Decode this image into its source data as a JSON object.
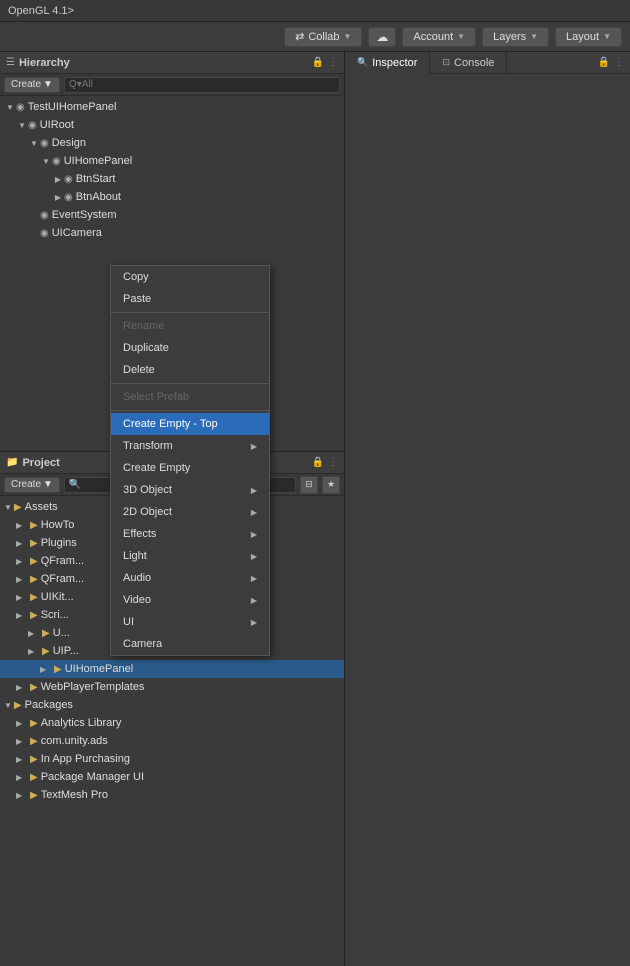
{
  "titleBar": {
    "text": "OpenGL 4.1>"
  },
  "toolbar": {
    "collab": "Collab",
    "account": "Account",
    "layers": "Layers",
    "layout": "Layout"
  },
  "hierarchy": {
    "title": "Hierarchy",
    "createBtn": "Create",
    "searchPlaceholder": "Q▾All",
    "items": [
      {
        "label": "TestUIHomePanel",
        "indent": 0,
        "toggle": "▼",
        "icon": "◉",
        "type": "root"
      },
      {
        "label": "UIRoot",
        "indent": 1,
        "toggle": "▼",
        "icon": "◉"
      },
      {
        "label": "Design",
        "indent": 2,
        "toggle": "▼",
        "icon": "◉"
      },
      {
        "label": "UIHomePanel",
        "indent": 3,
        "toggle": "▼",
        "icon": "◉"
      },
      {
        "label": "BtnStart",
        "indent": 4,
        "toggle": "▶",
        "icon": "◉"
      },
      {
        "label": "BtnAbout",
        "indent": 4,
        "toggle": "▶",
        "icon": "◉"
      },
      {
        "label": "EventSystem",
        "indent": 2,
        "toggle": "",
        "icon": "◉"
      },
      {
        "label": "UICamera",
        "indent": 2,
        "toggle": "",
        "icon": "◉"
      }
    ]
  },
  "contextMenu": {
    "items": [
      {
        "label": "Copy",
        "type": "normal"
      },
      {
        "label": "Paste",
        "type": "normal"
      },
      {
        "type": "separator"
      },
      {
        "label": "Rename",
        "type": "disabled"
      },
      {
        "label": "Duplicate",
        "type": "normal"
      },
      {
        "label": "Delete",
        "type": "normal"
      },
      {
        "type": "separator"
      },
      {
        "label": "Select Prefab",
        "type": "disabled"
      },
      {
        "type": "separator"
      },
      {
        "label": "Create Empty - Top",
        "type": "highlighted"
      },
      {
        "label": "Transform",
        "type": "submenu"
      },
      {
        "label": "Create Empty",
        "type": "normal"
      },
      {
        "label": "3D Object",
        "type": "submenu"
      },
      {
        "label": "2D Object",
        "type": "submenu"
      },
      {
        "label": "Effects",
        "type": "submenu"
      },
      {
        "label": "Light",
        "type": "submenu"
      },
      {
        "label": "Audio",
        "type": "submenu"
      },
      {
        "label": "Video",
        "type": "submenu"
      },
      {
        "label": "UI",
        "type": "submenu"
      },
      {
        "label": "Camera",
        "type": "normal"
      }
    ]
  },
  "project": {
    "title": "Project",
    "createBtn": "Create",
    "folders": {
      "assets": {
        "label": "Assets",
        "children": [
          {
            "label": "HowTo",
            "indent": 1
          },
          {
            "label": "Plugins",
            "indent": 1
          },
          {
            "label": "QFram...",
            "indent": 1
          },
          {
            "label": "QFram...",
            "indent": 1
          },
          {
            "label": "UIKit...",
            "indent": 1
          },
          {
            "label": "Scri...",
            "indent": 1
          },
          {
            "label": "U...",
            "indent": 2
          },
          {
            "label": "UIP...",
            "indent": 2
          },
          {
            "label": "UIHomePanel",
            "indent": 3
          },
          {
            "label": "WebPlayerTemplates",
            "indent": 1
          }
        ]
      },
      "packages": {
        "label": "Packages",
        "children": [
          {
            "label": "Analytics Library",
            "indent": 1
          },
          {
            "label": "com.unity.ads",
            "indent": 1
          },
          {
            "label": "In App Purchasing",
            "indent": 1
          },
          {
            "label": "Package Manager UI",
            "indent": 1
          },
          {
            "label": "TextMesh Pro",
            "indent": 1
          }
        ]
      }
    }
  },
  "rightPanel": {
    "tabs": [
      {
        "label": "Inspector",
        "icon": "🔍",
        "active": true
      },
      {
        "label": "Console",
        "icon": "⊡",
        "active": false
      }
    ]
  },
  "colors": {
    "highlighted": "#2a6bba",
    "folderIcon": "#d4aa55",
    "bg": "#3c3c3c",
    "panelBg": "#3a3a3a",
    "headerBg": "#3d3d3d",
    "border": "#222"
  }
}
